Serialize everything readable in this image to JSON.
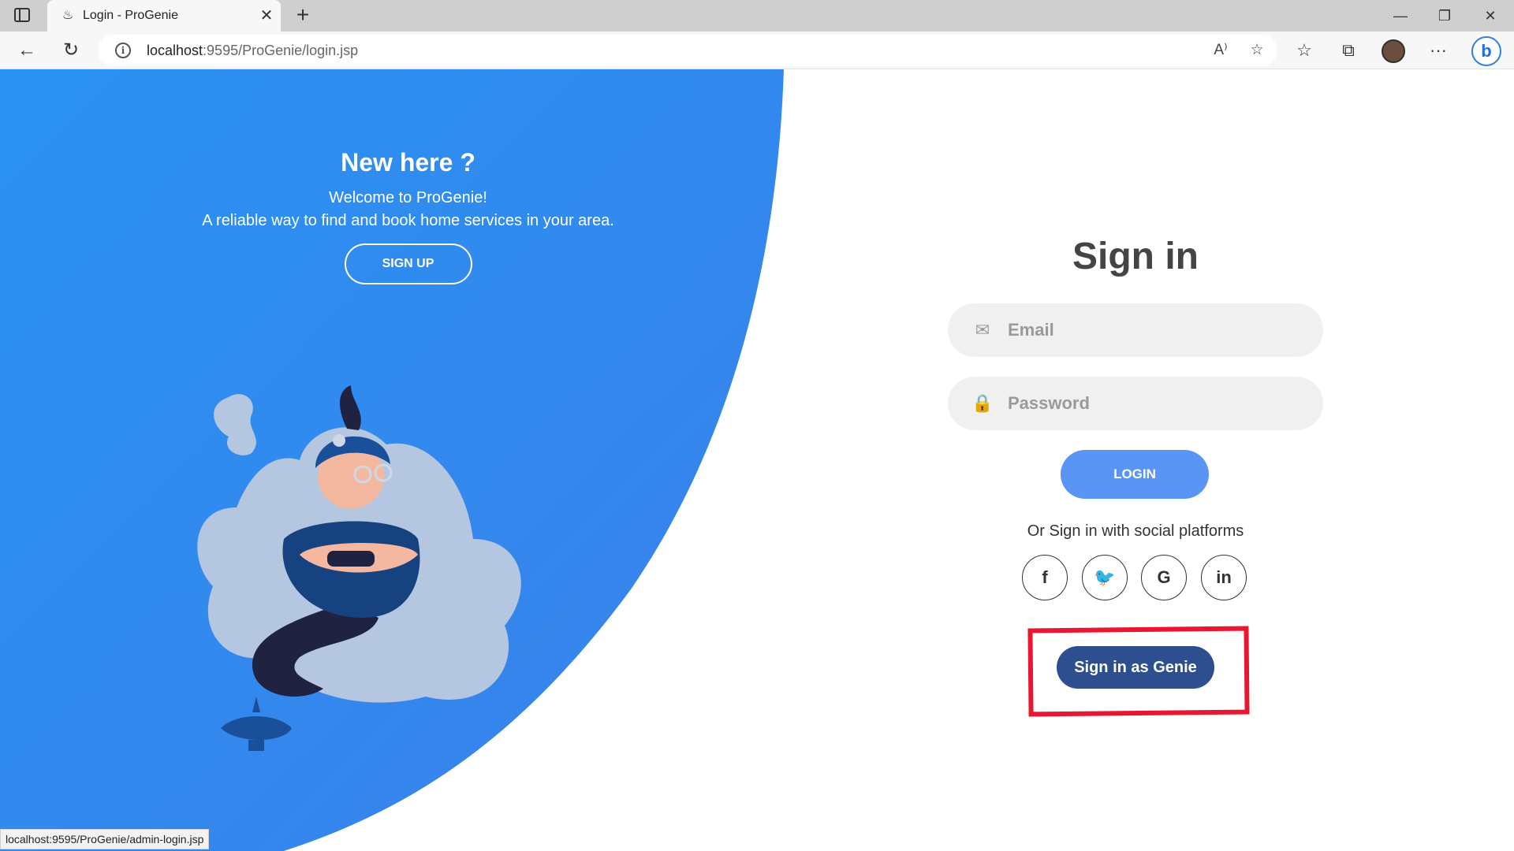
{
  "browser": {
    "tab_title": "Login - ProGenie",
    "url_host": "localhost",
    "url_rest": ":9595/ProGenie/login.jsp",
    "status_url": "localhost:9595/ProGenie/admin-login.jsp",
    "icons": {
      "sidebar": "tab-sidebar-icon",
      "back": "back-arrow-icon",
      "reload": "reload-icon",
      "info": "info-icon",
      "read_aloud": "read-aloud-icon",
      "favorite_add": "add-favorite-icon",
      "favorites": "favorites-icon",
      "collections": "collections-icon",
      "more": "more-icon",
      "bing": "bing-icon"
    },
    "close_glyph": "✕",
    "new_tab_glyph": "+",
    "read_aloud_glyph": "A⁾",
    "bing_glyph": "b"
  },
  "hero": {
    "title": "New here ?",
    "line1": "Welcome to ProGenie!",
    "line2": "A reliable way to find and book home services in your area.",
    "signup_label": "SIGN UP"
  },
  "signin": {
    "title": "Sign in",
    "email_placeholder": "Email",
    "password_placeholder": "Password",
    "login_label": "LOGIN",
    "social_text": "Or Sign in with social platforms",
    "social": [
      {
        "name": "facebook",
        "glyph": "f"
      },
      {
        "name": "twitter",
        "glyph": "🐦"
      },
      {
        "name": "google",
        "glyph": "G"
      },
      {
        "name": "linkedin",
        "glyph": "in"
      }
    ],
    "genie_label": "Sign in as Genie"
  },
  "colors": {
    "blue_panel": "#2f8ff0",
    "login_button": "#5a95f5",
    "genie_button": "#2e4f8f",
    "highlight": "#e8172f",
    "title_text": "#444444"
  }
}
